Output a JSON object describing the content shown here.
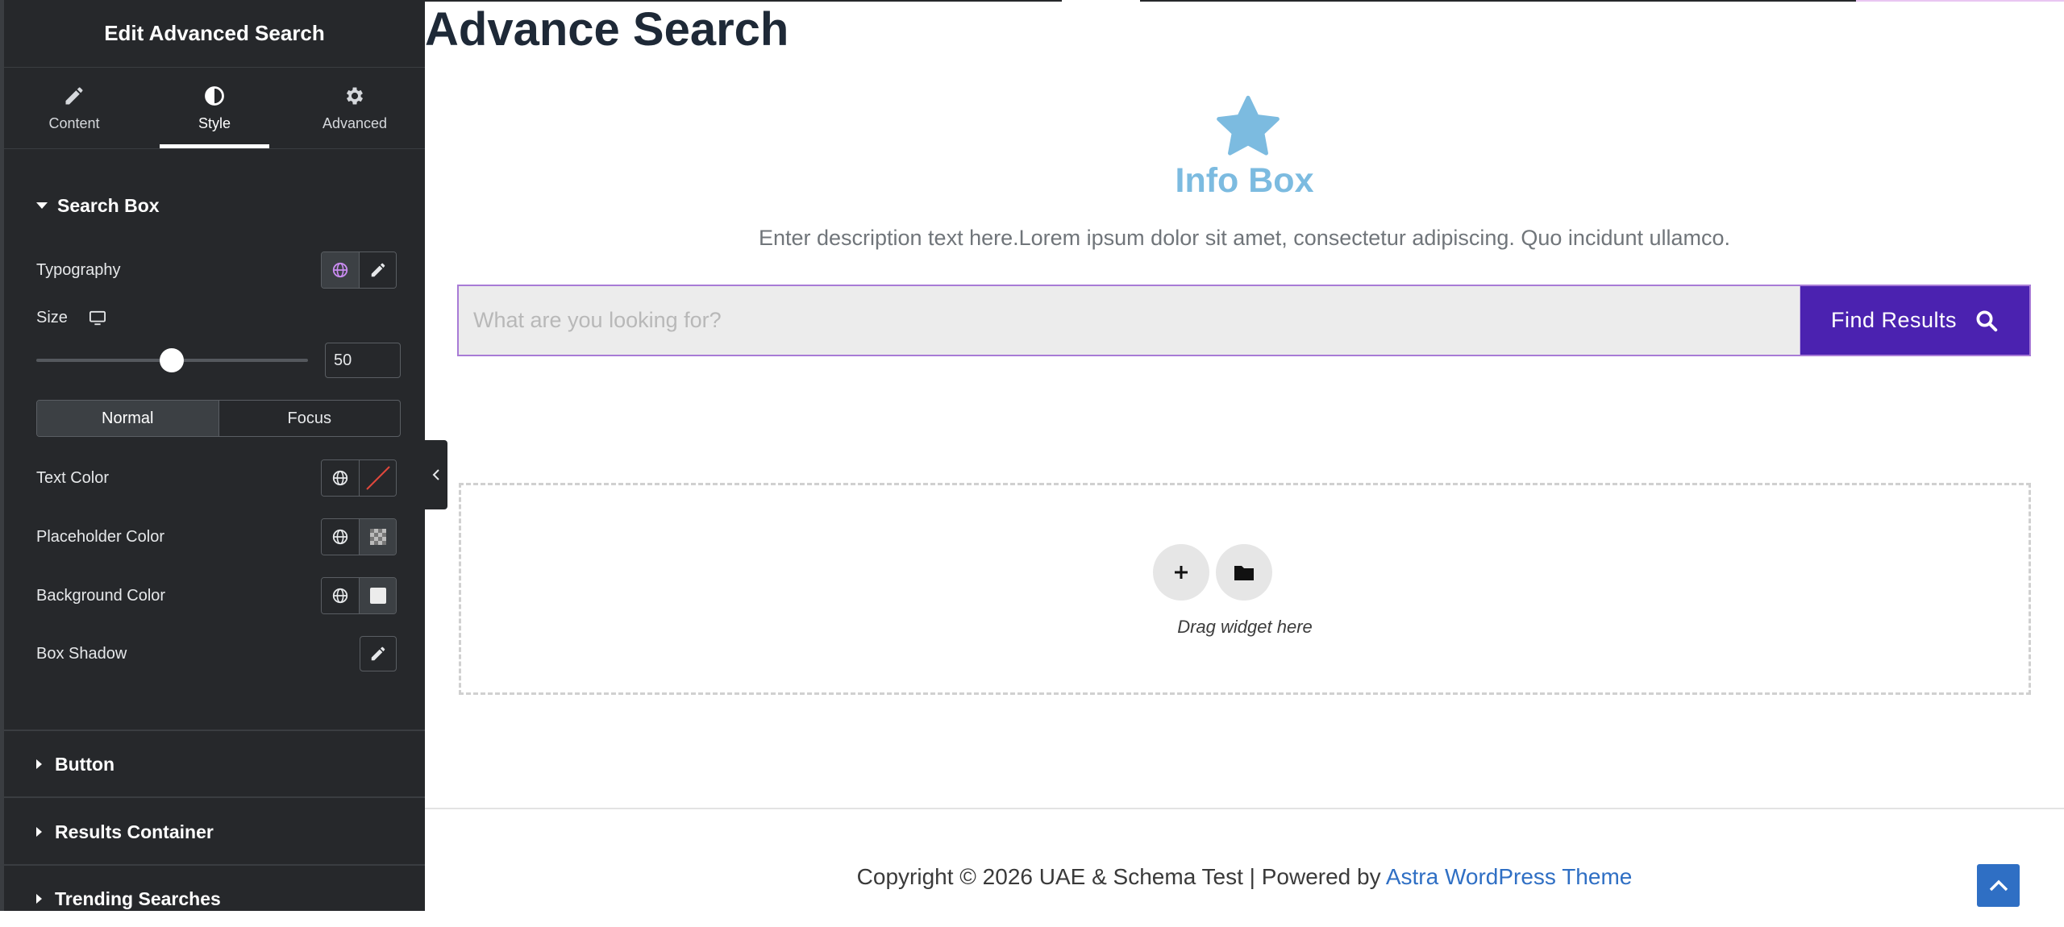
{
  "panel": {
    "title": "Edit Advanced Search",
    "tabs": [
      {
        "label": "Content",
        "icon": "pencil-icon"
      },
      {
        "label": "Style",
        "icon": "half-circle-icon"
      },
      {
        "label": "Advanced",
        "icon": "gear-icon"
      }
    ],
    "active_tab": "Style",
    "section_open": "Search Box",
    "controls": {
      "typography": "Typography",
      "size": "Size",
      "size_value": "50",
      "size_fraction": 0.5,
      "state_normal": "Normal",
      "state_focus": "Focus",
      "text_color": "Text Color",
      "placeholder_color": "Placeholder Color",
      "background_color": "Background Color",
      "box_shadow": "Box Shadow"
    },
    "sections_closed": [
      "Button",
      "Results Container",
      "Trending Searches"
    ]
  },
  "canvas": {
    "page_title": "Advance Search",
    "info_box_title": "Info Box",
    "info_box_desc": "Enter description text here.Lorem ipsum dolor sit amet, consectetur adipiscing. Quo incidunt ullamco.",
    "search_placeholder": "What are you looking for?",
    "search_button": "Find Results",
    "drag_text": "Drag widget here",
    "footer_text": "Copyright © 2026 UAE & Schema Test | Powered by ",
    "footer_link": "Astra WordPress Theme"
  },
  "colors": {
    "sidebar_bg": "#26282b",
    "accent_purple": "#4b22b0",
    "info_blue": "#7cbbe0",
    "link_blue": "#2f6fc4"
  }
}
